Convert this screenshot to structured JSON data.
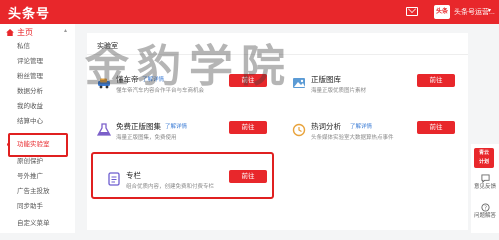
{
  "header": {
    "logo": "头条号",
    "avatar_text": "头条",
    "username": "头条号运营...",
    "brand_color": "#e8272b"
  },
  "sidebar": {
    "home": "主页",
    "items": [
      {
        "label": "私信"
      },
      {
        "label": "评论管理"
      },
      {
        "label": "粉丝管理"
      },
      {
        "label": "数据分析"
      },
      {
        "label": "我的收益"
      },
      {
        "label": "结算中心"
      },
      {
        "label": "功能实验室",
        "active": true
      },
      {
        "label": "原创保护"
      },
      {
        "label": "号外推广"
      },
      {
        "label": "广告主投放"
      },
      {
        "label": "同步助手"
      },
      {
        "label": "自定义菜单"
      }
    ]
  },
  "main": {
    "title": "实验室",
    "detail_label": "了解详情",
    "go_label": "前往",
    "cards": [
      {
        "title": "懂车帝",
        "desc": "懂车帝汽车内容合作平台与车商机会"
      },
      {
        "title": "正版图库",
        "desc": "海量正版优质图片素材"
      },
      {
        "title": "免费正版图集",
        "desc": "海量正版图集，免费使用"
      },
      {
        "title": "热词分析",
        "desc": "头条媒体实验室大数据算热点事件"
      },
      {
        "title": "专栏",
        "desc": "组合优质内容，创建免费和付费专栏"
      }
    ]
  },
  "watermark": "金豹学院",
  "right_panel": {
    "badge_line1": "青云",
    "badge_line2": "计划",
    "feedback": "意见反馈",
    "faq": "问题解答"
  }
}
